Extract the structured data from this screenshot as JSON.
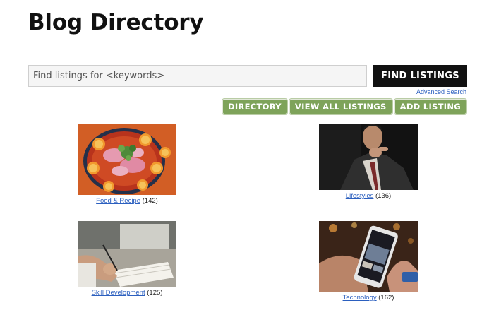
{
  "page": {
    "title": "Blog Directory"
  },
  "search": {
    "placeholder": "Find listings for <keywords>",
    "button_label": "FIND LISTINGS",
    "advanced_link": "Advanced Search"
  },
  "nav": {
    "directory": "DIRECTORY",
    "view_all": "VIEW ALL LISTINGS",
    "add_listing": "ADD LISTING"
  },
  "categories": [
    {
      "name": "Food & Recipe",
      "count": "(142)",
      "image": "food-plate-image"
    },
    {
      "name": "Lifestyles",
      "count": "(136)",
      "image": "man-in-suit-image"
    },
    {
      "name": "Skill Development",
      "count": "(125)",
      "image": "writing-notebook-image"
    },
    {
      "name": "Technology",
      "count": "(162)",
      "image": "smartphone-hand-image"
    }
  ],
  "colors": {
    "accent_green": "#7ea35a",
    "button_dark": "#111111",
    "link_blue": "#2b5fbf"
  }
}
